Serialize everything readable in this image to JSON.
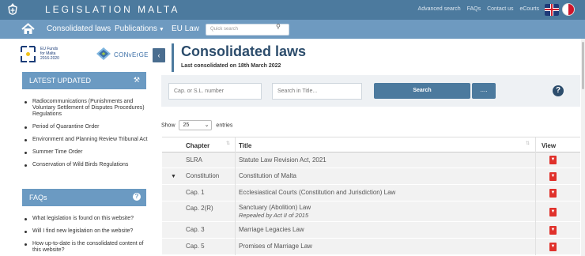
{
  "topbar": {
    "title": "LEGISLATION MALTA",
    "links": [
      "Advanced search",
      "FAQs",
      "Contact us",
      "eCourts"
    ]
  },
  "nav": {
    "items": [
      "Consolidated laws",
      "Publications",
      "EU Law"
    ],
    "quick_search_placeholder": "Quick search"
  },
  "sidebar": {
    "eu_logo_text": [
      "EU Funds",
      "for Malta",
      "2016-2020"
    ],
    "converge_text": "CONvErGE",
    "latest_heading": "LATEST UPDATED",
    "latest_items": [
      "Radiocommunications (Punishments and Voluntary Settlement of Disputes Procedures) Regulations",
      "Period of Quarantine Order",
      "Environment and Planning Review Tribunal Act",
      "Summer Time Order",
      "Conservation of Wild Birds Regulations"
    ],
    "faq_heading": "FAQs",
    "faq_items": [
      "What legislation is found on this website?",
      "Will I find new legislation on the website?",
      "How up-to-date is the consolidated content of this website?"
    ]
  },
  "main": {
    "title": "Consolidated laws",
    "subtitle": "Last consolidated on 18th March 2022",
    "cap_placeholder": "Cap. or S.L. number",
    "title_search_placeholder": "Search in Title...",
    "search_label": "Search",
    "more_label": "....",
    "show_label": "Show",
    "entries_value": "25",
    "entries_label": "entries"
  },
  "table": {
    "headers": [
      "Chapter",
      "Title",
      "View"
    ],
    "rows": [
      {
        "chapter": "SLRA",
        "title": "Statute Law Revision Act, 2021",
        "note": ""
      },
      {
        "chapter": "Constitution",
        "title": "Constitution of Malta",
        "note": ""
      },
      {
        "chapter": "Cap. 1",
        "title": "Ecclesiastical Courts (Constitution and Jurisdiction) Law",
        "note": ""
      },
      {
        "chapter": "Cap. 2(R)",
        "title": "Sanctuary (Abolition) Law",
        "note": "Repealed by Act II of 2015"
      },
      {
        "chapter": "Cap. 3",
        "title": "Marriage Legacies Law",
        "note": ""
      },
      {
        "chapter": "Cap. 5",
        "title": "Promises of Marriage Law",
        "note": ""
      }
    ]
  },
  "colors": {
    "topbar": "#4c7a9e",
    "navbar": "#6e9ac0",
    "accent": "#2d4d6c",
    "pdf": "#e0312b"
  }
}
